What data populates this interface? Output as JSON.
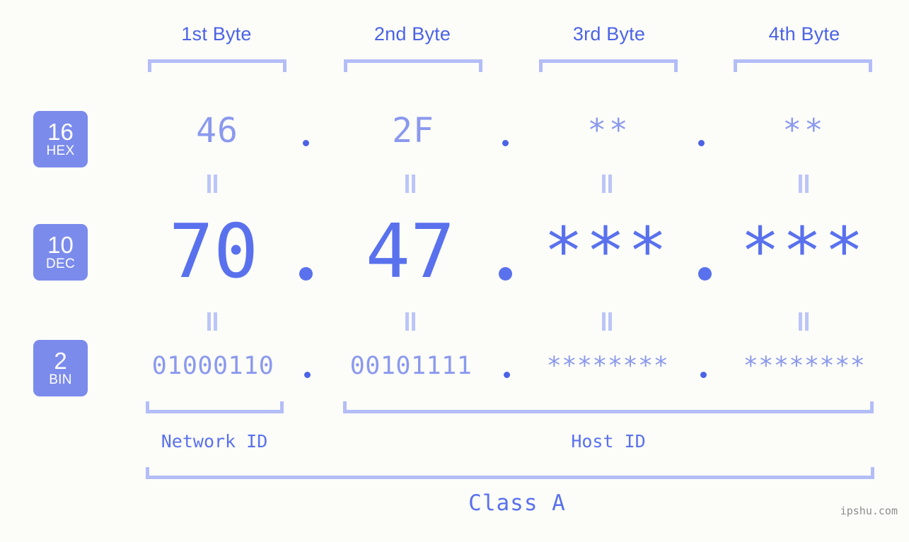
{
  "bases": [
    {
      "key": "hex",
      "number": "16",
      "name": "HEX"
    },
    {
      "key": "dec",
      "number": "10",
      "name": "DEC"
    },
    {
      "key": "bin",
      "number": "2",
      "name": "BIN"
    }
  ],
  "byte_headers": [
    {
      "label": "1st Byte"
    },
    {
      "label": "2nd Byte"
    },
    {
      "label": "3rd Byte"
    },
    {
      "label": "4th Byte"
    }
  ],
  "rows": {
    "hex": {
      "base_number": "16",
      "base_name": "HEX",
      "values": [
        "46",
        "2F",
        "**",
        "**"
      ],
      "separator": "."
    },
    "dec": {
      "base_number": "10",
      "base_name": "DEC",
      "values": [
        "70",
        "47",
        "***",
        "***"
      ],
      "separator": "."
    },
    "bin": {
      "base_number": "2",
      "base_name": "BIN",
      "values": [
        "01000110",
        "00101111",
        "********",
        "********"
      ],
      "separator": "."
    }
  },
  "equals_marker": "||",
  "segments": [
    {
      "label": "Network ID"
    },
    {
      "label": "Host ID"
    }
  ],
  "class": {
    "label": "Class A"
  },
  "watermark": {
    "text": "ipshu.com"
  },
  "colors": {
    "background": "#fcfdf9",
    "accent_strong": "#4c63e6",
    "accent_mid": "#5a71ed",
    "accent_light": "#8b99ee",
    "bracket": "#b3bdf7",
    "badge_fill": "#7b8bec",
    "badge_text": "#ffffff",
    "watermark_text": "#8d8d8d"
  }
}
